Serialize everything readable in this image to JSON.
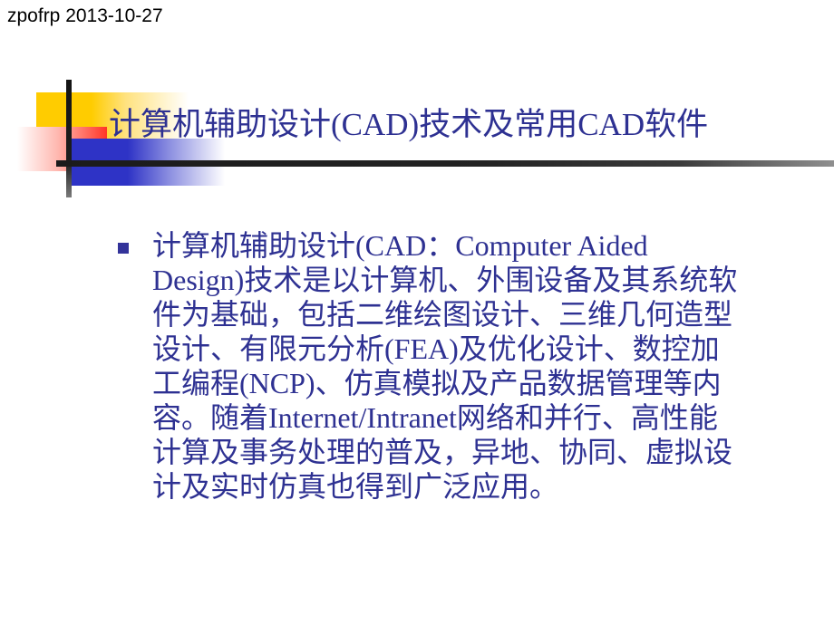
{
  "header": {
    "label": "zpofrp 2013-10-27"
  },
  "slide": {
    "title": "计算机辅助设计(CAD)技术及常用CAD软件",
    "background_color": "#FFFFFF",
    "title_color": "#2E3192",
    "body_color": "#2E3192"
  },
  "decoration": {
    "yellow_color": "#FFCC00",
    "red_color": "#FF3526",
    "blue_color": "#2E33C6",
    "rule_color": "#1B1B1B"
  },
  "body": {
    "bullets": [
      {
        "marker": "square-bullet",
        "marker_color": "#33339A",
        "lines": [
          "计算机辅助设计(CAD：Computer Aided",
          "Design)技术是以计算机、外围设备及其系统软",
          "件为基础，包括二维绘图设计、三维几何造型",
          "设计、有限元分析(FEA)及优化设计、数控加",
          "工编程(NCP)、仿真模拟及产品数据管理等内",
          "容。随着Internet/Intranet网络和并行、高性能",
          "计算及事务处理的普及，异地、协同、虚拟设",
          "计及实时仿真也得到广泛应用。"
        ]
      }
    ]
  }
}
